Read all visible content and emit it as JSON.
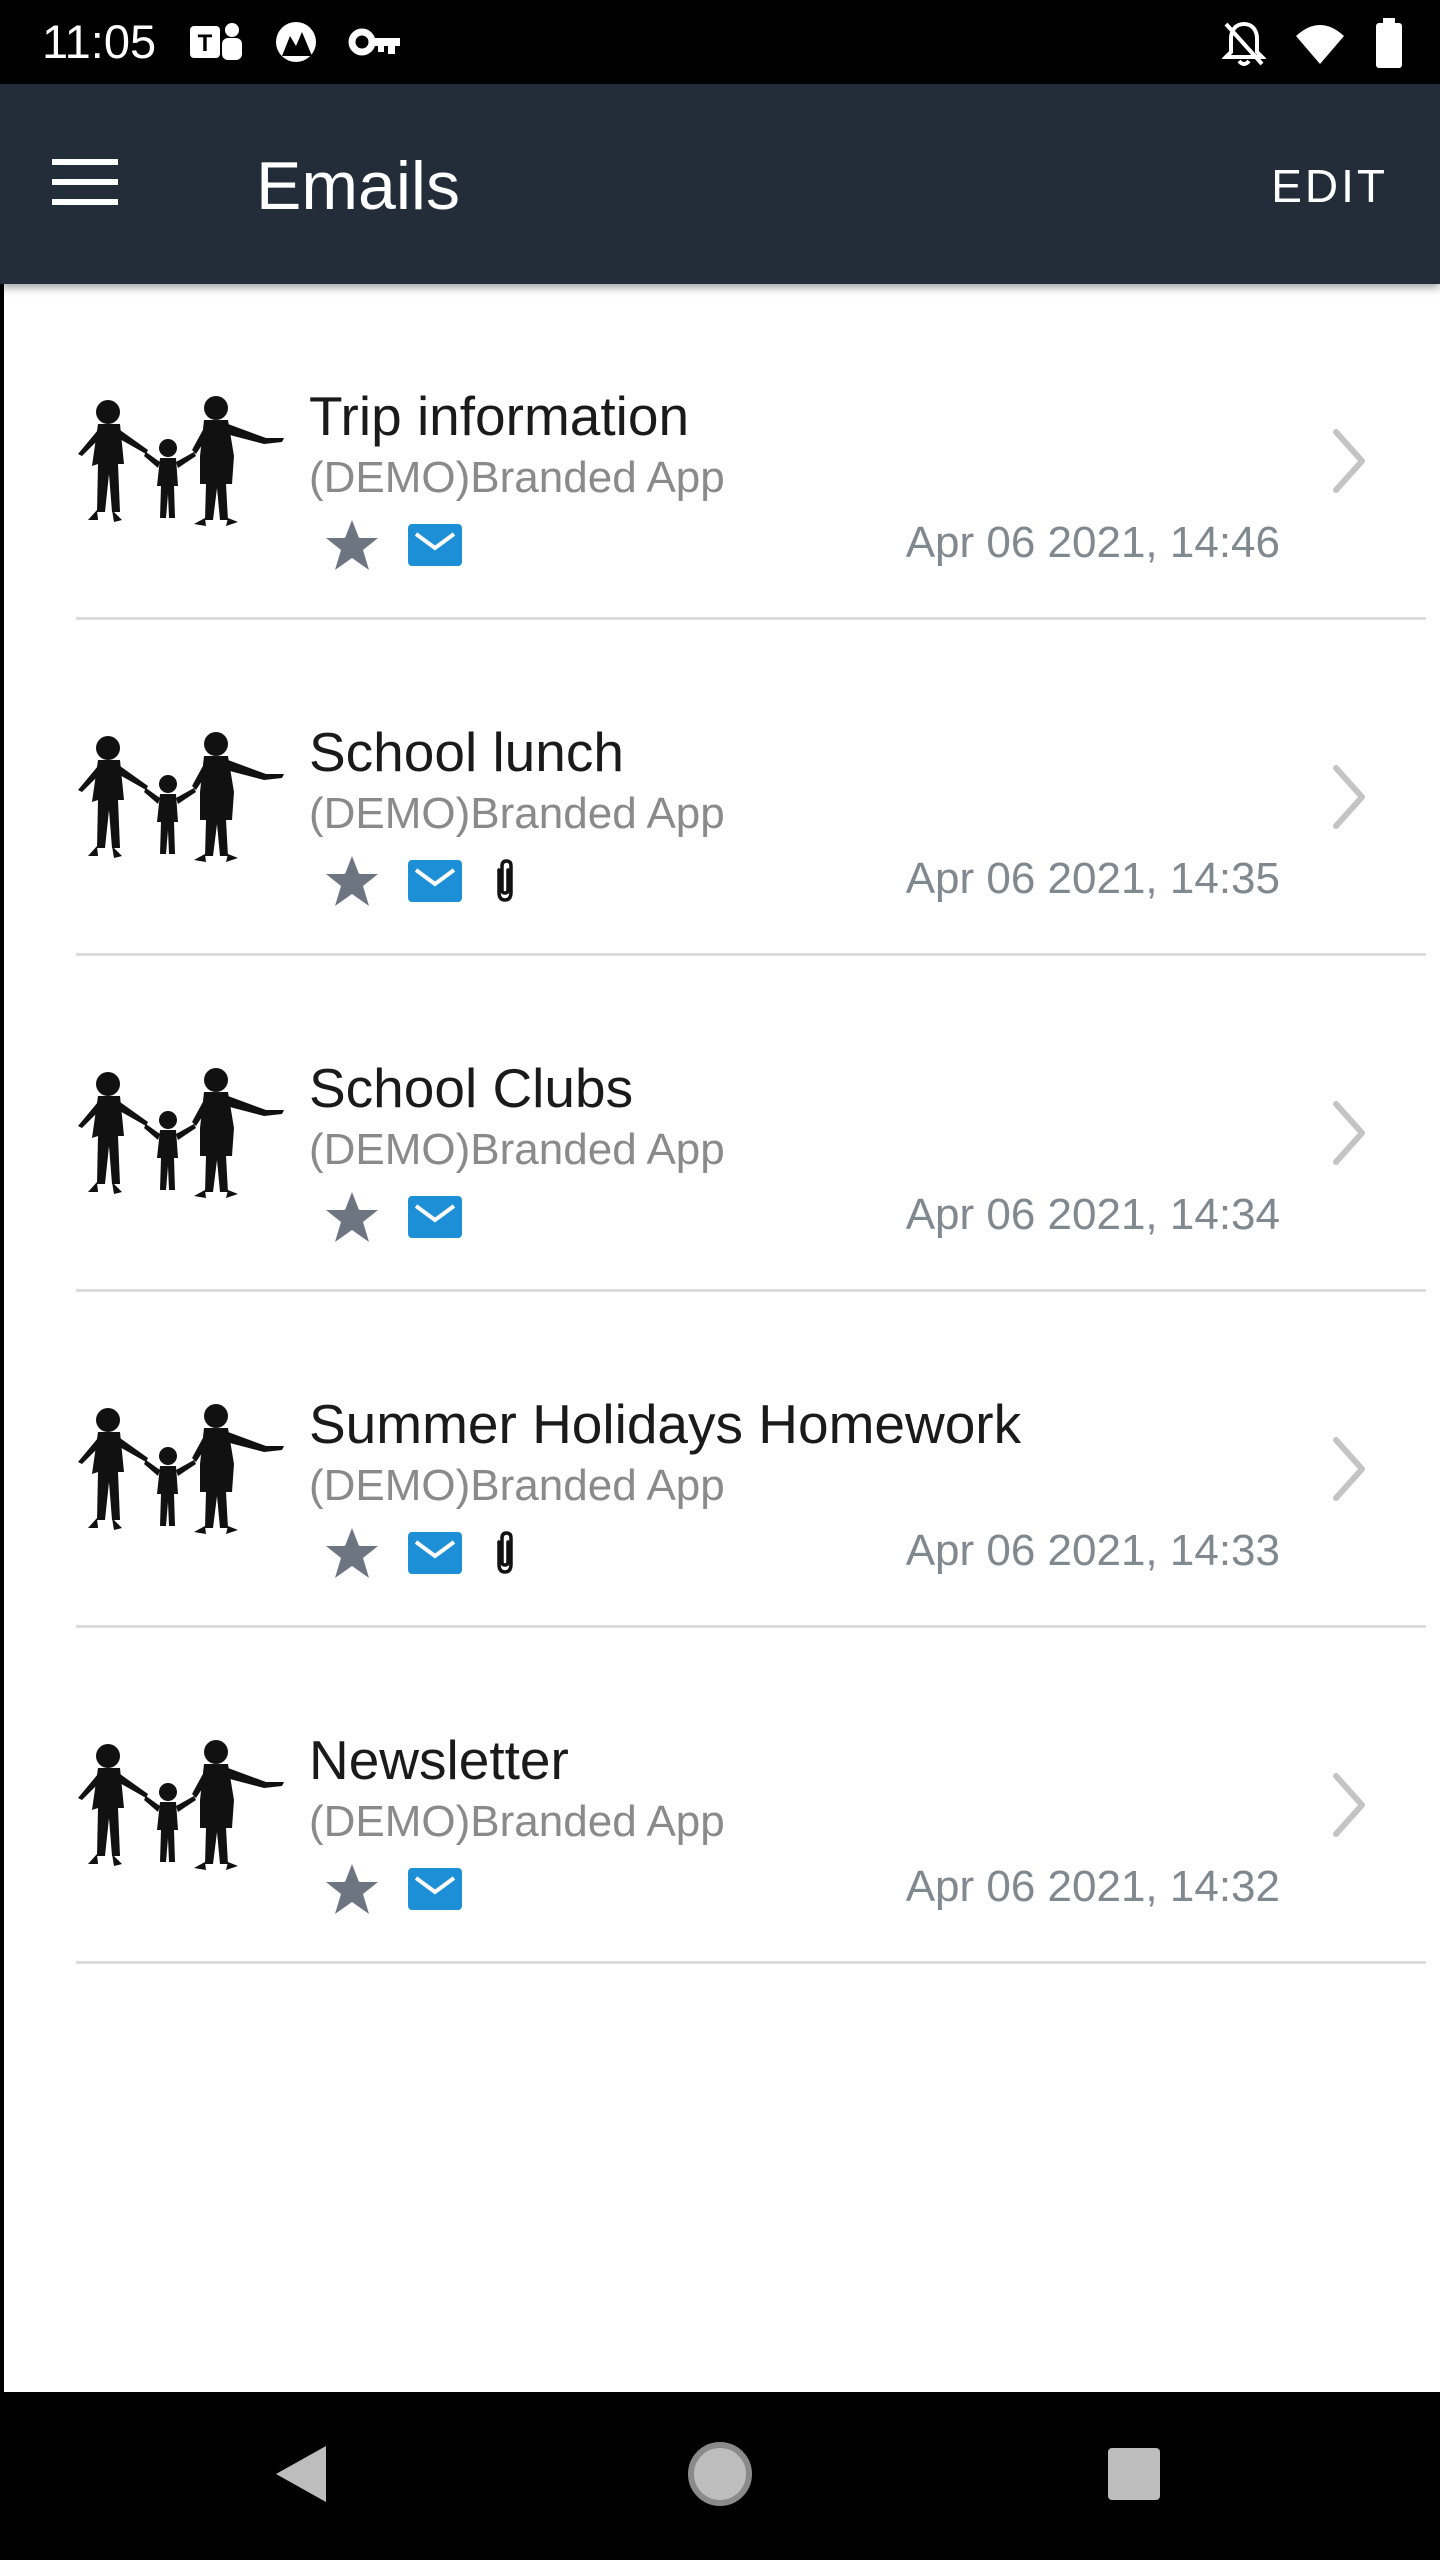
{
  "status_bar": {
    "time": "11:05",
    "left_icons": [
      "teams-icon",
      "app-notification-icon",
      "vpn-key-icon"
    ],
    "right_icons": [
      "notifications-off-icon",
      "wifi-icon",
      "battery-icon"
    ]
  },
  "app_bar": {
    "title": "Emails",
    "edit_label": "EDIT",
    "menu_icon": "hamburger-menu-icon"
  },
  "colors": {
    "app_bar_bg": "#232d3a",
    "accent_blue": "#1d8fd6",
    "star_gray": "#6d7680",
    "secondary_text": "#8a8a8a"
  },
  "emails": [
    {
      "subject": "Trip information",
      "sender": "(DEMO)Branded App",
      "date": "Apr 06 2021, 14:46",
      "has_attachment": false
    },
    {
      "subject": "School lunch",
      "sender": "(DEMO)Branded App",
      "date": "Apr 06 2021, 14:35",
      "has_attachment": true
    },
    {
      "subject": "School Clubs",
      "sender": "(DEMO)Branded App",
      "date": "Apr 06 2021, 14:34",
      "has_attachment": false
    },
    {
      "subject": "Summer Holidays Homework",
      "sender": "(DEMO)Branded App",
      "date": "Apr 06 2021, 14:33",
      "has_attachment": true
    },
    {
      "subject": "Newsletter",
      "sender": "(DEMO)Branded App",
      "date": "Apr 06 2021, 14:32",
      "has_attachment": false
    }
  ],
  "nav_bar": {
    "buttons": [
      "back-icon",
      "home-icon",
      "recents-icon"
    ]
  }
}
